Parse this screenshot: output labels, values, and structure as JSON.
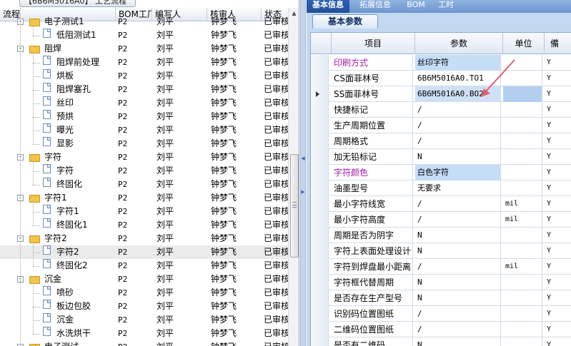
{
  "app": {
    "top_tab": "【6B6M5016A0】 工艺流程"
  },
  "left": {
    "headers": {
      "flow": "流程",
      "bom": "BOM工厂",
      "writer": "编写人",
      "reviewer": "核审人",
      "status": "状态"
    },
    "rows": [
      {
        "level": 1,
        "type": "folder",
        "toggle": "-",
        "name": "电子测试1",
        "bom": "P2",
        "writer": "刘平",
        "reviewer": "钟梦飞",
        "status": "已审核"
      },
      {
        "level": 2,
        "type": "doc",
        "name": "低阻测试1",
        "bom": "P2",
        "writer": "刘平",
        "reviewer": "钟梦飞",
        "status": "已审核"
      },
      {
        "level": 1,
        "type": "folder",
        "toggle": "-",
        "name": "阻焊",
        "bom": "P2",
        "writer": "刘平",
        "reviewer": "钟梦飞",
        "status": "已审核"
      },
      {
        "level": 2,
        "type": "doc",
        "name": "阻焊前处理",
        "bom": "P2",
        "writer": "刘平",
        "reviewer": "钟梦飞",
        "status": "已审核"
      },
      {
        "level": 2,
        "type": "doc",
        "name": "烘板",
        "bom": "P2",
        "writer": "刘平",
        "reviewer": "钟梦飞",
        "status": "已审核"
      },
      {
        "level": 2,
        "type": "doc",
        "name": "阻焊塞孔",
        "bom": "P2",
        "writer": "刘平",
        "reviewer": "钟梦飞",
        "status": "已审核"
      },
      {
        "level": 2,
        "type": "doc",
        "name": "丝印",
        "bom": "P2",
        "writer": "刘平",
        "reviewer": "钟梦飞",
        "status": "已审核"
      },
      {
        "level": 2,
        "type": "doc",
        "name": "预烘",
        "bom": "P2",
        "writer": "刘平",
        "reviewer": "钟梦飞",
        "status": "已审核"
      },
      {
        "level": 2,
        "type": "doc",
        "name": "曝光",
        "bom": "P2",
        "writer": "刘平",
        "reviewer": "钟梦飞",
        "status": "已审核"
      },
      {
        "level": 2,
        "type": "doc",
        "name": "显影",
        "bom": "P2",
        "writer": "刘平",
        "reviewer": "钟梦飞",
        "status": "已审核"
      },
      {
        "level": 1,
        "type": "folder",
        "toggle": "-",
        "name": "字符",
        "bom": "P2",
        "writer": "刘平",
        "reviewer": "钟梦飞",
        "status": "已审核"
      },
      {
        "level": 2,
        "type": "doc",
        "name": "字符",
        "bom": "P2",
        "writer": "刘平",
        "reviewer": "钟梦飞",
        "status": "已审核"
      },
      {
        "level": 2,
        "type": "doc",
        "name": "终固化",
        "bom": "P2",
        "writer": "刘平",
        "reviewer": "钟梦飞",
        "status": "已审核"
      },
      {
        "level": 1,
        "type": "folder",
        "toggle": "-",
        "name": "字符1",
        "bom": "P2",
        "writer": "刘平",
        "reviewer": "钟梦飞",
        "status": "已审核"
      },
      {
        "level": 2,
        "type": "doc",
        "name": "字符1",
        "bom": "P2",
        "writer": "刘平",
        "reviewer": "钟梦飞",
        "status": "已审核"
      },
      {
        "level": 2,
        "type": "doc",
        "name": "终固化1",
        "bom": "P2",
        "writer": "刘平",
        "reviewer": "钟梦飞",
        "status": "已审核"
      },
      {
        "level": 1,
        "type": "folder",
        "toggle": "-",
        "name": "字符2",
        "bom": "P2",
        "writer": "刘平",
        "reviewer": "钟梦飞",
        "status": "已审核"
      },
      {
        "level": 2,
        "type": "doc",
        "name": "字符2",
        "bom": "P2",
        "writer": "刘平",
        "reviewer": "钟梦飞",
        "status": "已审核",
        "selected": true
      },
      {
        "level": 2,
        "type": "doc",
        "name": "终固化2",
        "bom": "P2",
        "writer": "刘平",
        "reviewer": "钟梦飞",
        "status": "已审核"
      },
      {
        "level": 1,
        "type": "folder",
        "toggle": "-",
        "name": "沉金",
        "bom": "P2",
        "writer": "刘平",
        "reviewer": "钟梦飞",
        "status": "已审核"
      },
      {
        "level": 2,
        "type": "doc",
        "name": "喷砂",
        "bom": "P2",
        "writer": "刘平",
        "reviewer": "钟梦飞",
        "status": "已审核"
      },
      {
        "level": 2,
        "type": "doc",
        "name": "板边包胶",
        "bom": "P2",
        "writer": "刘平",
        "reviewer": "钟梦飞",
        "status": "已审核"
      },
      {
        "level": 2,
        "type": "doc",
        "name": "沉金",
        "bom": "P2",
        "writer": "刘平",
        "reviewer": "钟梦飞",
        "status": "已审核"
      },
      {
        "level": 2,
        "type": "doc",
        "name": "水洗烘干",
        "bom": "P2",
        "writer": "刘平",
        "reviewer": "钟梦飞",
        "status": "已审核"
      },
      {
        "level": 1,
        "type": "folder",
        "toggle": "-",
        "name": "电子测试",
        "bom": "P2",
        "writer": "刘平",
        "reviewer": "钟梦飞",
        "status": "已审核"
      }
    ]
  },
  "right": {
    "tabs": [
      {
        "label": "基本信息",
        "active": true
      },
      {
        "label": "拓展信息",
        "active": false
      },
      {
        "label": "BOM",
        "active": false
      },
      {
        "label": "工时",
        "active": false
      }
    ],
    "subtab": "基本参数",
    "headers": {
      "item": "项目",
      "param": "参数",
      "unit": "单位",
      "extra": "備"
    },
    "rows": [
      {
        "item": "印刷方式",
        "param": "丝印字符",
        "unit": "",
        "flag": "Y",
        "highlight": true,
        "param_blue": true
      },
      {
        "item": "CS面菲林号",
        "param": "6B6M5016A0.TO1",
        "unit": "",
        "flag": "Y"
      },
      {
        "item": "SS面菲林号",
        "param": "6B6M5016A0.BO2",
        "unit": "",
        "flag": "Y",
        "current": true
      },
      {
        "item": "快捷标记",
        "param": "/",
        "unit": "",
        "flag": "Y"
      },
      {
        "item": "生产周期位置",
        "param": "/",
        "unit": "",
        "flag": "Y"
      },
      {
        "item": "周期格式",
        "param": "/",
        "unit": "",
        "flag": "Y"
      },
      {
        "item": "加无铅标记",
        "param": "N",
        "unit": "",
        "flag": "Y"
      },
      {
        "item": "字符颜色",
        "param": "白色字符",
        "unit": "",
        "flag": "Y",
        "highlight": true,
        "param_blue": true
      },
      {
        "item": "油墨型号",
        "param": "无要求",
        "unit": "",
        "flag": "Y"
      },
      {
        "item": "最小字符线宽",
        "param": "/",
        "unit": "mil",
        "flag": "Y"
      },
      {
        "item": "最小字符高度",
        "param": "/",
        "unit": "mil",
        "flag": "Y"
      },
      {
        "item": "周期是否为阴字",
        "param": "N",
        "unit": "",
        "flag": "Y"
      },
      {
        "item": "字符上表面处理设计",
        "param": "N",
        "unit": "",
        "flag": "Y"
      },
      {
        "item": "字符到焊盘最小距离",
        "param": "/",
        "unit": "mil",
        "flag": "Y"
      },
      {
        "item": "字符框代替周期",
        "param": "N",
        "unit": "",
        "flag": "Y"
      },
      {
        "item": "是否存在生产型号",
        "param": "N",
        "unit": "",
        "flag": "Y"
      },
      {
        "item": "识别码位置图纸",
        "param": "/",
        "unit": "",
        "flag": "Y"
      },
      {
        "item": "二维码位置图纸",
        "param": "/",
        "unit": "",
        "flag": "Y"
      },
      {
        "item": "是否有二维码",
        "param": "N",
        "unit": "",
        "flag": "Y"
      }
    ]
  },
  "colors": {
    "selection_bg": "#eaeaea",
    "tab_active": "#234f97",
    "cell_blue": "#c6ddf7",
    "highlight_text": "#a21ca9",
    "arrow": "#e2606a"
  }
}
